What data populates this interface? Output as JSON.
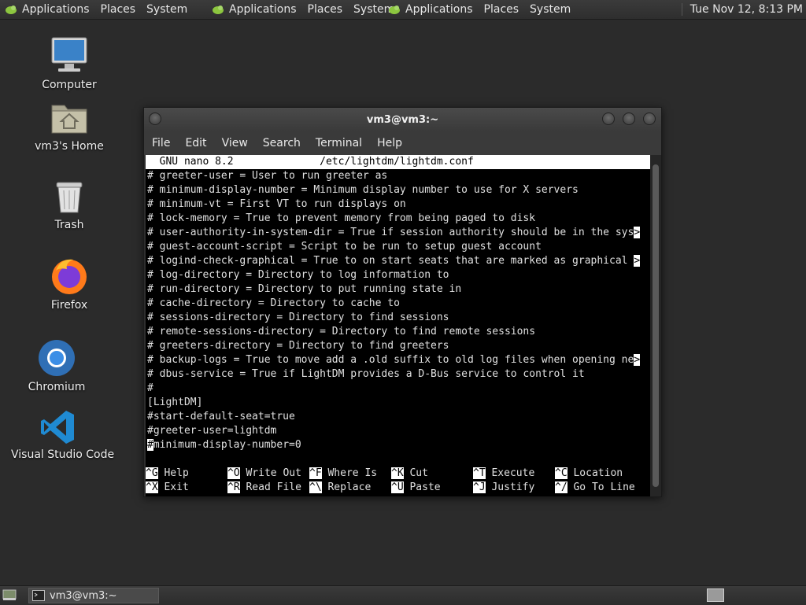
{
  "top_panel": {
    "menu_groups": [
      {
        "applications": "Applications",
        "places": "Places",
        "system": "System"
      },
      {
        "applications": "Applications",
        "places": "Places",
        "system": "System"
      },
      {
        "applications": "Applications",
        "places": "Places",
        "system": "System"
      }
    ],
    "clock": "Tue Nov 12,  8:13 PM"
  },
  "desktop_icons": [
    {
      "label": "Computer",
      "icon": "computer-icon"
    },
    {
      "label": "vm3's Home",
      "icon": "home-folder-icon"
    },
    {
      "label": "Trash",
      "icon": "trash-icon"
    },
    {
      "label": "Firefox",
      "icon": "firefox-icon"
    },
    {
      "label": "Chromium",
      "icon": "chromium-icon"
    },
    {
      "label": "Visual Studio Code",
      "icon": "vscode-icon"
    }
  ],
  "window": {
    "title": "vm3@vm3:~",
    "menu": [
      "File",
      "Edit",
      "View",
      "Search",
      "Terminal",
      "Help"
    ]
  },
  "nano": {
    "header": "  GNU nano 8.2              /etc/lightdm/lightdm.conf",
    "lines": [
      {
        "text": "# greeter-user = User to run greeter as",
        "truncated": false
      },
      {
        "text": "# minimum-display-number = Minimum display number to use for X servers",
        "truncated": false
      },
      {
        "text": "# minimum-vt = First VT to run displays on",
        "truncated": false
      },
      {
        "text": "# lock-memory = True to prevent memory from being paged to disk",
        "truncated": false
      },
      {
        "text": "# user-authority-in-system-dir = True if session authority should be in the sys",
        "truncated": true
      },
      {
        "text": "# guest-account-script = Script to be run to setup guest account",
        "truncated": false
      },
      {
        "text": "# logind-check-graphical = True to on start seats that are marked as graphical ",
        "truncated": true
      },
      {
        "text": "# log-directory = Directory to log information to",
        "truncated": false
      },
      {
        "text": "# run-directory = Directory to put running state in",
        "truncated": false
      },
      {
        "text": "# cache-directory = Directory to cache to",
        "truncated": false
      },
      {
        "text": "# sessions-directory = Directory to find sessions",
        "truncated": false
      },
      {
        "text": "# remote-sessions-directory = Directory to find remote sessions",
        "truncated": false
      },
      {
        "text": "# greeters-directory = Directory to find greeters",
        "truncated": false
      },
      {
        "text": "# backup-logs = True to move add a .old suffix to old log files when opening ne",
        "truncated": true
      },
      {
        "text": "# dbus-service = True if LightDM provides a D-Bus service to control it",
        "truncated": false
      },
      {
        "text": "#",
        "truncated": false
      },
      {
        "text": "[LightDM]",
        "truncated": false
      },
      {
        "text": "#start-default-seat=true",
        "truncated": false
      },
      {
        "text": "#greeter-user=lightdm",
        "truncated": false
      }
    ],
    "cursor_line": {
      "cursor_char": "#",
      "rest": "minimum-display-number=0"
    },
    "truncation_marker": ">",
    "shortcuts_row1": [
      {
        "key": "^G",
        "label": "Help"
      },
      {
        "key": "^O",
        "label": "Write Out"
      },
      {
        "key": "^F",
        "label": "Where Is"
      },
      {
        "key": "^K",
        "label": "Cut"
      },
      {
        "key": "^T",
        "label": "Execute"
      },
      {
        "key": "^C",
        "label": "Location"
      }
    ],
    "shortcuts_row2": [
      {
        "key": "^X",
        "label": "Exit"
      },
      {
        "key": "^R",
        "label": "Read File"
      },
      {
        "key": "^\\",
        "label": "Replace"
      },
      {
        "key": "^U",
        "label": "Paste"
      },
      {
        "key": "^J",
        "label": "Justify"
      },
      {
        "key": "^/",
        "label": "Go To Line"
      }
    ]
  },
  "taskbar": {
    "task_label": "vm3@vm3:~"
  }
}
